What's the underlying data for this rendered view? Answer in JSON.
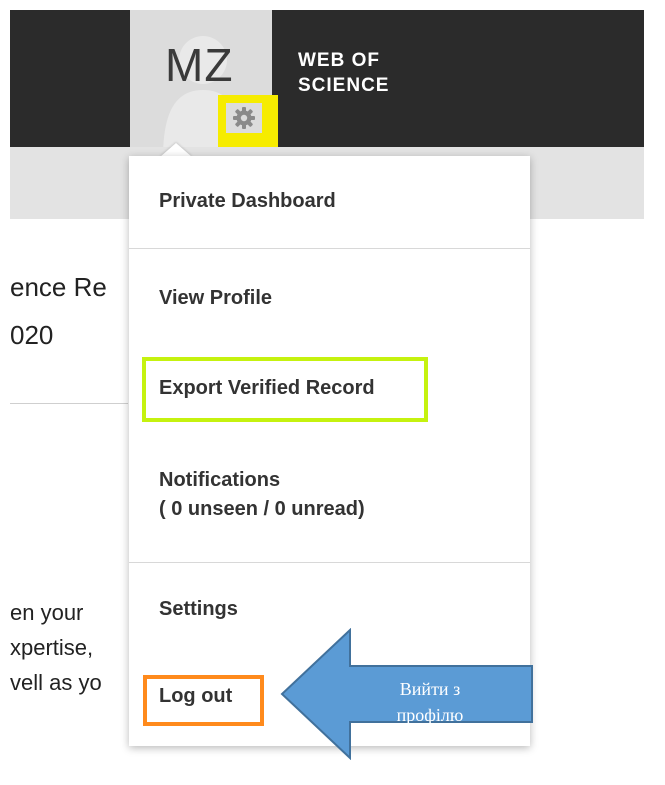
{
  "header": {
    "avatar_initials": "MZ",
    "brand_line1": "WEB OF",
    "brand_line2": "SCIENCE",
    "gear_icon": "gear-icon"
  },
  "background": {
    "heading_fragment": "ence Re",
    "year_fragment": "020",
    "body_lines": [
      "en your",
      "xpertise,",
      "vell as yo"
    ]
  },
  "menu": {
    "private_dashboard": "Private Dashboard",
    "view_profile": "View Profile",
    "export_verified_record": "Export Verified Record",
    "notifications": "Notifications",
    "notifications_count": "( 0 unseen / 0 unread)",
    "settings": "Settings",
    "log_out": "Log out"
  },
  "annotation": {
    "callout_line1": "Вийти з",
    "callout_line2": "профілю"
  },
  "colors": {
    "topbar": "#2b2b2b",
    "gear_highlight": "#f6ec00",
    "export_highlight": "#c5f20f",
    "logout_highlight": "#ff8a1c",
    "arrow_fill": "#5b9bd5",
    "arrow_stroke": "#41719c"
  }
}
